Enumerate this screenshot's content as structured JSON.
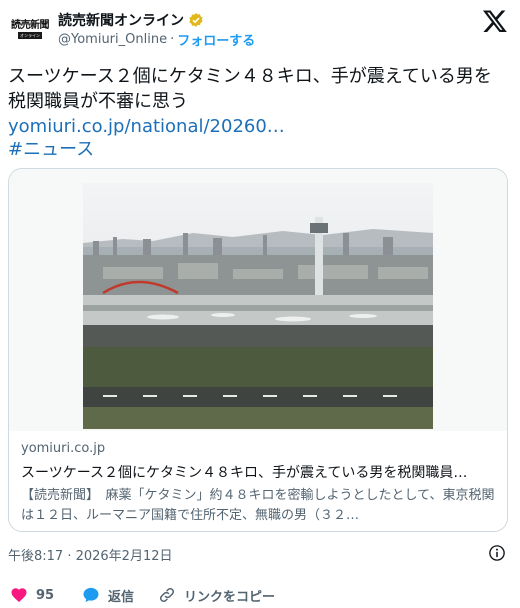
{
  "account": {
    "logo_text": "読売新聞",
    "logo_sub": "オンライン",
    "display_name": "読売新聞オンライン",
    "handle": "@Yomiuri_Online",
    "separator": "·",
    "follow_label": "フォローする"
  },
  "tweet": {
    "text": "スーツケース２個にケタミン４８キロ、手が震えている男を税関職員が不審に思う",
    "link": "yomiuri.co.jp/national/20260…",
    "hashtag": "#ニュース"
  },
  "card": {
    "domain": "yomiuri.co.jp",
    "title": "スーツケース２個にケタミン４８キロ、手が震えている男を税関職員…",
    "description": "【読売新聞】　麻薬「ケタミン」約４８キロを密輸しようとしたとして、東京税関は１２日、ルーマニア国籍で住所不定、無職の男（３２…"
  },
  "meta": {
    "timestamp": "午後8:17 · 2026年2月12日"
  },
  "actions": {
    "like_count": "95",
    "reply_label": "返信",
    "copy_label": "リンクをコピー"
  },
  "colors": {
    "like": "#f91880",
    "reply": "#1d9bf0",
    "link": "#1d6fb8",
    "verified": "#e2b719"
  },
  "icons": [
    "verified-badge-icon",
    "x-logo-icon",
    "info-icon",
    "heart-icon",
    "reply-bubble-icon",
    "link-icon"
  ]
}
